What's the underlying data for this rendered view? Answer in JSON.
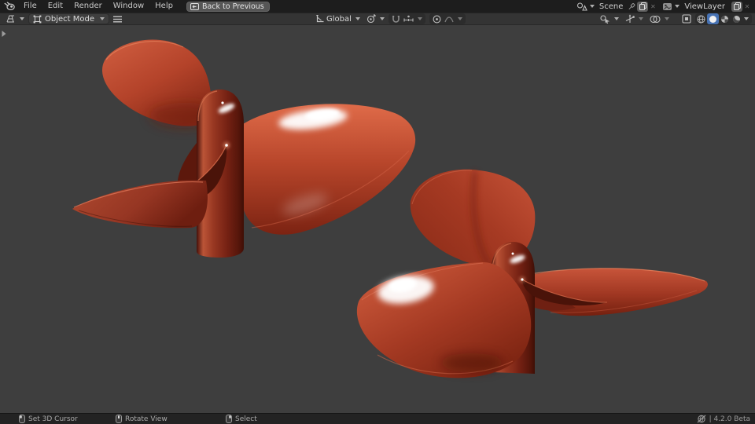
{
  "topbar": {
    "menus": [
      "File",
      "Edit",
      "Render",
      "Window",
      "Help"
    ],
    "back_button": "Back to Previous",
    "scene_label": "Scene",
    "viewlayer_label": "ViewLayer"
  },
  "viewport_header": {
    "mode": "Object Mode",
    "orientation": "Global"
  },
  "statusbar": {
    "hints": [
      {
        "mouse_button": "left",
        "label": "Set 3D Cursor"
      },
      {
        "mouse_button": "middle",
        "label": "Rotate View"
      },
      {
        "mouse_button": "right",
        "label": "Select"
      }
    ],
    "version": "| 4.2.0 Beta"
  },
  "scene": {
    "objects": [
      "propeller-left",
      "propeller-right"
    ],
    "shading_mode_active": "Solid"
  },
  "colors": {
    "accent_blue": "#4772b3",
    "viewport_bg": "#3e3e3e",
    "topbar_bg": "#1d1d1d",
    "header_bg": "#343434",
    "propeller_red": "#b5432a",
    "propeller_dark": "#5f1a0d",
    "specular": "#ffffff"
  }
}
